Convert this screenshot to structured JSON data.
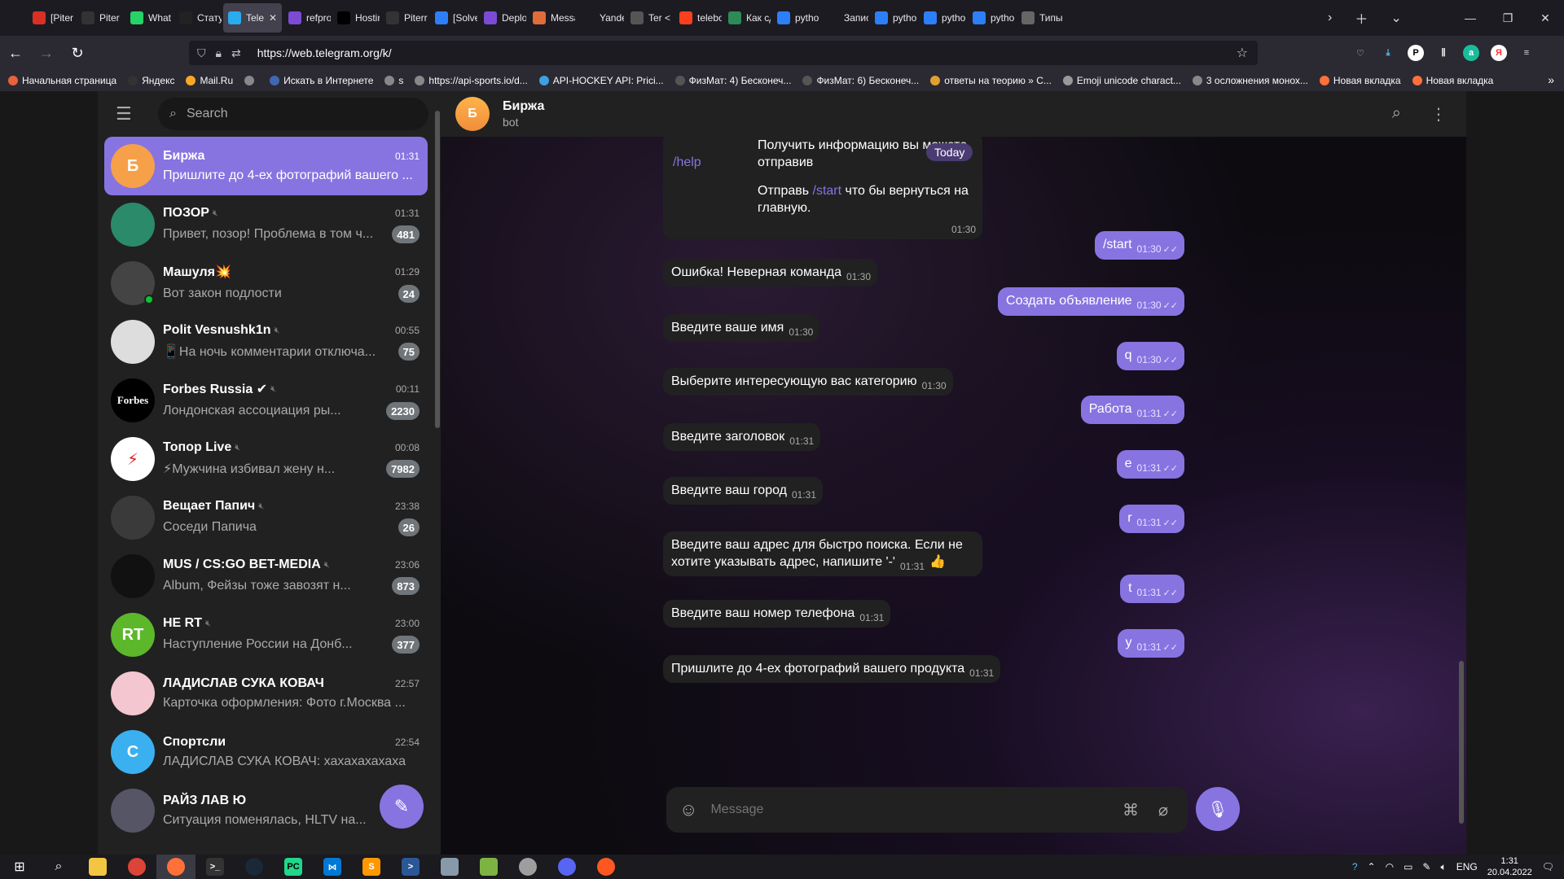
{
  "browser": {
    "tabs": [
      {
        "label": "[Piter",
        "icon": "gmail-icon",
        "color": "#d93025"
      },
      {
        "label": "Piter",
        "icon": "github-icon",
        "color": "#333"
      },
      {
        "label": "What",
        "icon": "whatsapp-icon",
        "color": "#25d366"
      },
      {
        "label": "Стату",
        "icon": "k-icon",
        "color": "#222"
      },
      {
        "label": "Tele",
        "icon": "telegram-icon",
        "color": "#2aabee",
        "active": true
      },
      {
        "label": "refpro",
        "icon": "h-icon",
        "color": "#7b4bd6"
      },
      {
        "label": "Hostin",
        "icon": "dev-icon",
        "color": "#000"
      },
      {
        "label": "Piterr",
        "icon": "github-icon",
        "color": "#333"
      },
      {
        "label": "[Solve",
        "icon": "so-icon",
        "color": "#2d7ff9"
      },
      {
        "label": "Deplo",
        "icon": "h-icon",
        "color": "#7b4bd6"
      },
      {
        "label": "Messa",
        "icon": "sound-icon",
        "color": "#e06c3a"
      },
      {
        "label": "Yandex.Co",
        "icon": "",
        "color": "transparent"
      },
      {
        "label": "Ter <",
        "icon": "t-icon",
        "color": "#555"
      },
      {
        "label": "telebo",
        "icon": "yandex-icon",
        "color": "#fc3f1d"
      },
      {
        "label": "Как сд",
        "icon": "green-icon",
        "color": "#2e8b57"
      },
      {
        "label": "pytho",
        "icon": "so-icon",
        "color": "#2d7ff9"
      },
      {
        "label": "Запись ку",
        "icon": "",
        "color": "transparent"
      },
      {
        "label": "pytho",
        "icon": "so-icon",
        "color": "#2d7ff9"
      },
      {
        "label": "pytho",
        "icon": "so-icon",
        "color": "#2d7ff9"
      },
      {
        "label": "pytho",
        "icon": "so-icon",
        "color": "#2d7ff9"
      },
      {
        "label": "Типы",
        "icon": "doc-icon",
        "color": "#666"
      }
    ],
    "url": "https://web.telegram.org/k/",
    "bookmarks": [
      "Начальная страница",
      "Яндекс",
      "Mail.Ru",
      "",
      "Искать в Интернете",
      "s",
      "https://api-sports.io/d...",
      "API-HOCKEY API: Prici...",
      "ФизМат: 4) Бесконеч...",
      "ФизМат: 6) Бесконеч...",
      "ответы на теорию » С...",
      "Emoji unicode charact...",
      "3 осложнения монох...",
      "Новая вкладка",
      "Новая вкладка"
    ]
  },
  "sidebar": {
    "search_placeholder": "Search",
    "chats": [
      {
        "name": "Биржа",
        "time": "01:31",
        "preview": "Пришлите до 4-ех фотографий вашего ...",
        "badge": "",
        "avatar": "Б",
        "avcolor": "#f6a04a",
        "active": true
      },
      {
        "name": "ПОЗОР",
        "time": "01:31",
        "preview": "Привет, позор! Проблема в том ч...",
        "badge": "481",
        "avatar": "",
        "avcolor": "#2a8a6a",
        "muted": true
      },
      {
        "name": "Машуля💥",
        "time": "01:29",
        "preview": "Вот закон подлости",
        "badge": "24",
        "avatar": "",
        "avcolor": "#444",
        "online": true
      },
      {
        "name": "Polit Vesnushk1n",
        "time": "00:55",
        "preview": "📱На ночь комментарии отключа...",
        "badge": "75",
        "avatar": "",
        "avcolor": "#ddd",
        "muted": true
      },
      {
        "name": "Forbes Russia ✔",
        "time": "00:11",
        "preview": "Лондонская ассоциация ры...",
        "badge": "2230",
        "avatar": "Forbes",
        "avcolor": "#000",
        "muted": true
      },
      {
        "name": "Топор Live",
        "time": "00:08",
        "preview": "⚡Мужчина избивал жену н...",
        "badge": "7982",
        "avatar": "⚡",
        "avcolor": "#fff",
        "muted": true
      },
      {
        "name": "Вещает Папич",
        "time": "23:38",
        "preview": "Соседи Папича",
        "badge": "26",
        "avatar": "",
        "avcolor": "#3a3a3a",
        "muted": true
      },
      {
        "name": "MUS / CS:GO BET-MEDIA",
        "time": "23:06",
        "preview": "Album, Фейзы тоже завозят н...",
        "badge": "873",
        "avatar": "",
        "avcolor": "#111",
        "muted": true
      },
      {
        "name": "НЕ RT",
        "time": "23:00",
        "preview": "Наступление России на Донб...",
        "badge": "377",
        "avatar": "RT",
        "avcolor": "#5cb82a",
        "muted": true
      },
      {
        "name": "ЛАДИСЛАВ СУКА КОВАЧ",
        "time": "22:57",
        "preview": "Карточка оформления: Фото г.Москва ...",
        "badge": "",
        "avatar": "",
        "avcolor": "#f4c6d0"
      },
      {
        "name": "Спортсли",
        "time": "22:54",
        "preview": "ЛАДИСЛАВ СУКА КОВАЧ: хахахахахаха",
        "badge": "",
        "avatar": "С",
        "avcolor": "#3ab0f0"
      },
      {
        "name": "РАЙЗ ЛАВ Ю",
        "time": "",
        "preview": "Ситуация поменялась, HLTV на...",
        "badge": "",
        "avatar": "",
        "avcolor": "#556"
      }
    ]
  },
  "chat": {
    "title": "Биржа",
    "subtitle": "bot",
    "date_chip": "Today",
    "first_msg": {
      "pre": "Получить информацию вы можете отправив ",
      "cmd1": "/help",
      "mid": "Отправь ",
      "cmd2": "/start",
      "post": " что бы вернуться на главную.",
      "time": "01:30"
    },
    "messages": [
      {
        "dir": "out",
        "text": "/start",
        "time": "01:30"
      },
      {
        "dir": "in",
        "text": "Ошибка! Неверная команда",
        "time": "01:30"
      },
      {
        "dir": "out",
        "text": "Создать объявление",
        "time": "01:30"
      },
      {
        "dir": "in",
        "text": "Введите ваше имя",
        "time": "01:30"
      },
      {
        "dir": "out",
        "text": "q",
        "time": "01:30"
      },
      {
        "dir": "in",
        "text": "Выберите интересующую вас категорию",
        "time": "01:30"
      },
      {
        "dir": "out",
        "text": "Работа",
        "time": "01:31"
      },
      {
        "dir": "in",
        "text": "Введите заголовок",
        "time": "01:31"
      },
      {
        "dir": "out",
        "text": "e",
        "time": "01:31"
      },
      {
        "dir": "in",
        "text": "Введите ваш город",
        "time": "01:31"
      },
      {
        "dir": "out",
        "text": "r",
        "time": "01:31"
      },
      {
        "dir": "in",
        "text": "Введите ваш адрес для быстро поиска. Если не хотите указывать адрес, напишите '-'",
        "time": "01:31",
        "reaction": "👍"
      },
      {
        "dir": "out",
        "text": "t",
        "time": "01:31"
      },
      {
        "dir": "in",
        "text": "Введите ваш номер телефона",
        "time": "01:31"
      },
      {
        "dir": "out",
        "text": "y",
        "time": "01:31"
      },
      {
        "dir": "in",
        "text": "Пришлите до 4-ех фотографий вашего продукта",
        "time": "01:31"
      }
    ],
    "input_placeholder": "Message"
  },
  "taskbar": {
    "lang": "ENG",
    "time": "1:31",
    "date": "20.04.2022"
  }
}
